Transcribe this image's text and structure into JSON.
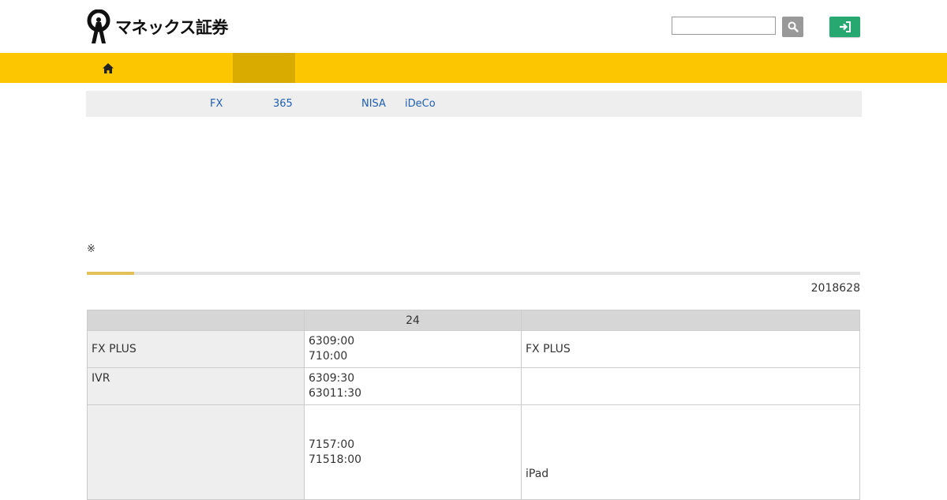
{
  "header": {
    "logo_text": "マネックス証券",
    "search_placeholder": ""
  },
  "nav": {
    "home_icon": "home-icon"
  },
  "subnav": {
    "links": [
      "FX",
      "365",
      "NISA",
      "iDeCo"
    ]
  },
  "note": "※",
  "date": "2018628",
  "table": {
    "headers": [
      "",
      "24",
      ""
    ],
    "rows": [
      {
        "label": "FX PLUS",
        "times": [
          "6309:00",
          "710:00"
        ],
        "remark": "FX PLUS"
      },
      {
        "label": "IVR",
        "times": [
          "6309:30",
          "63011:30"
        ],
        "remark": ""
      },
      {
        "label": "",
        "times": [
          "7157:00",
          "71518:00"
        ],
        "remark": "iPad"
      }
    ]
  },
  "colors": {
    "nav_bg": "#fdc700",
    "nav_active": "#d9aa00",
    "login": "#27a870",
    "link": "#1f5fb5"
  }
}
